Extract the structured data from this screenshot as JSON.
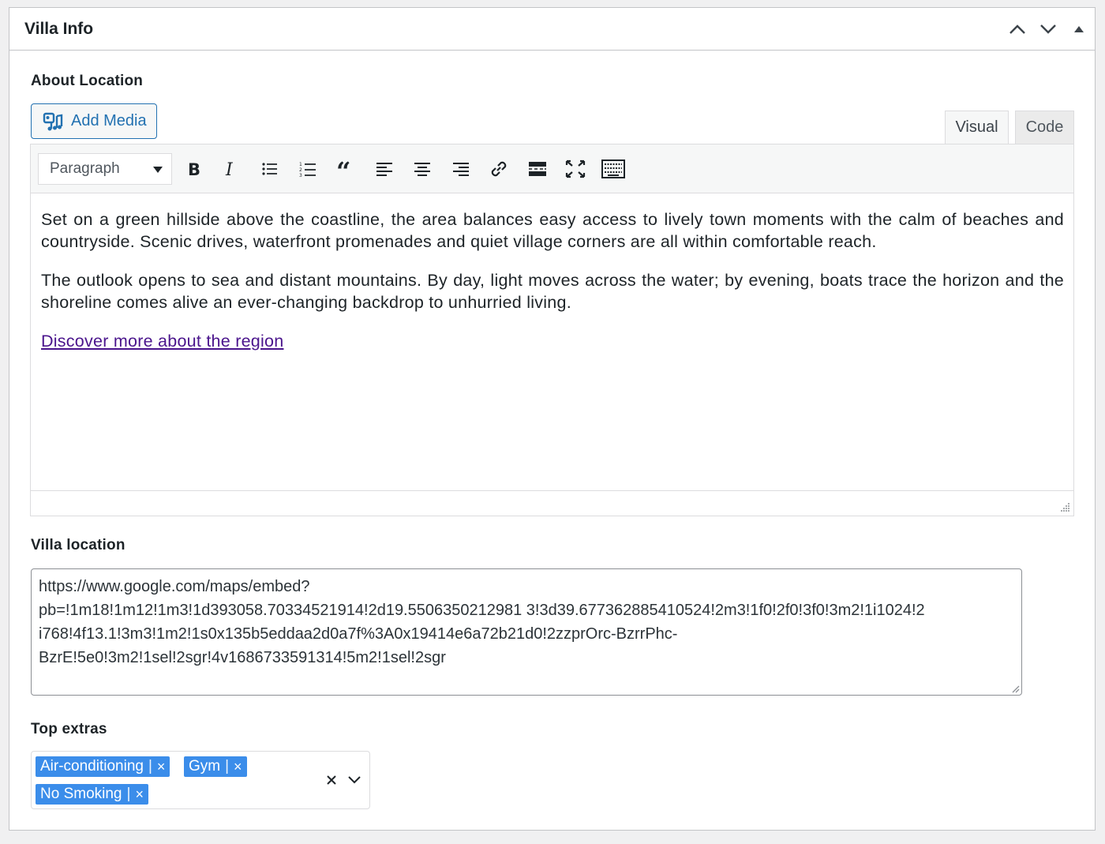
{
  "metabox": {
    "title": "Villa Info"
  },
  "about_location": {
    "label": "About Location",
    "add_media_label": "Add Media",
    "tabs": [
      {
        "label": "Visual",
        "active": true
      },
      {
        "label": "Code",
        "active": false
      }
    ],
    "toolbar": {
      "format_value": "Paragraph",
      "buttons": [
        "bold-icon",
        "italic-icon",
        "bulleted-list-icon",
        "numbered-list-icon",
        "blockquote-icon",
        "align-left-icon",
        "align-center-icon",
        "align-right-icon",
        "link-icon",
        "read-more-icon",
        "fullscreen-icon",
        "toolbar-toggle-icon"
      ]
    },
    "content": {
      "paragraph1": "Set on a green hillside above the coastline, the area balances easy access to lively town moments with the calm of beaches and countryside. Scenic drives, waterfront promenades and quiet village corners are all within comfortable reach.",
      "paragraph2": "The outlook opens to sea and distant mountains. By day, light moves across the water; by evening, boats trace the horizon and the shoreline comes alive an ever-changing backdrop to unhurried living.",
      "link_text": "Discover more about the region"
    }
  },
  "villa_location": {
    "label": "Villa location",
    "value": "https://www.google.com/maps/embed?pb=!1m18!1m12!1m3!1d393058.7033452191 4!2d19.5506350212981 3!3d39.67736288541052 4!2m3!1f0!2f0!3f0!3m2!1i1024!2i768!4f13.1!3m3!1m2!1s0x135b5eddaa2d0a7f%3A0x19414e6a72b21d0!2zzprOrc-BzrrPhc-BzrE!5e0!3m2!1sel!2sgr!4v1686733591314!5m2!1sel!2sgr",
    "lines": [
      "https://www.google.com/maps/embed?",
      "pb=!1m18!1m12!1m3!1d393058.70334521914!2d19.5506350212981 3!3d39.677362885410524!2m3!1f0!2f0!3f0!3m2!1i1024!2",
      "i768!4f13.1!3m3!1m2!1s0x135b5eddaa2d0a7f%3A0x19414e6a72b21d0!2zzprOrc-BzrrPhc-",
      "BzrE!5e0!3m2!1sel!2sgr!4v1686733591314!5m2!1sel!2sgr"
    ]
  },
  "top_extras": {
    "label": "Top extras",
    "selected": [
      "Air-conditioning",
      "Gym",
      "No Smoking"
    ],
    "separator": "|",
    "remove_glyph": "×"
  },
  "colors": {
    "accent": "#2271b1",
    "chip": "#3b8dea",
    "link": "#4a148c"
  }
}
